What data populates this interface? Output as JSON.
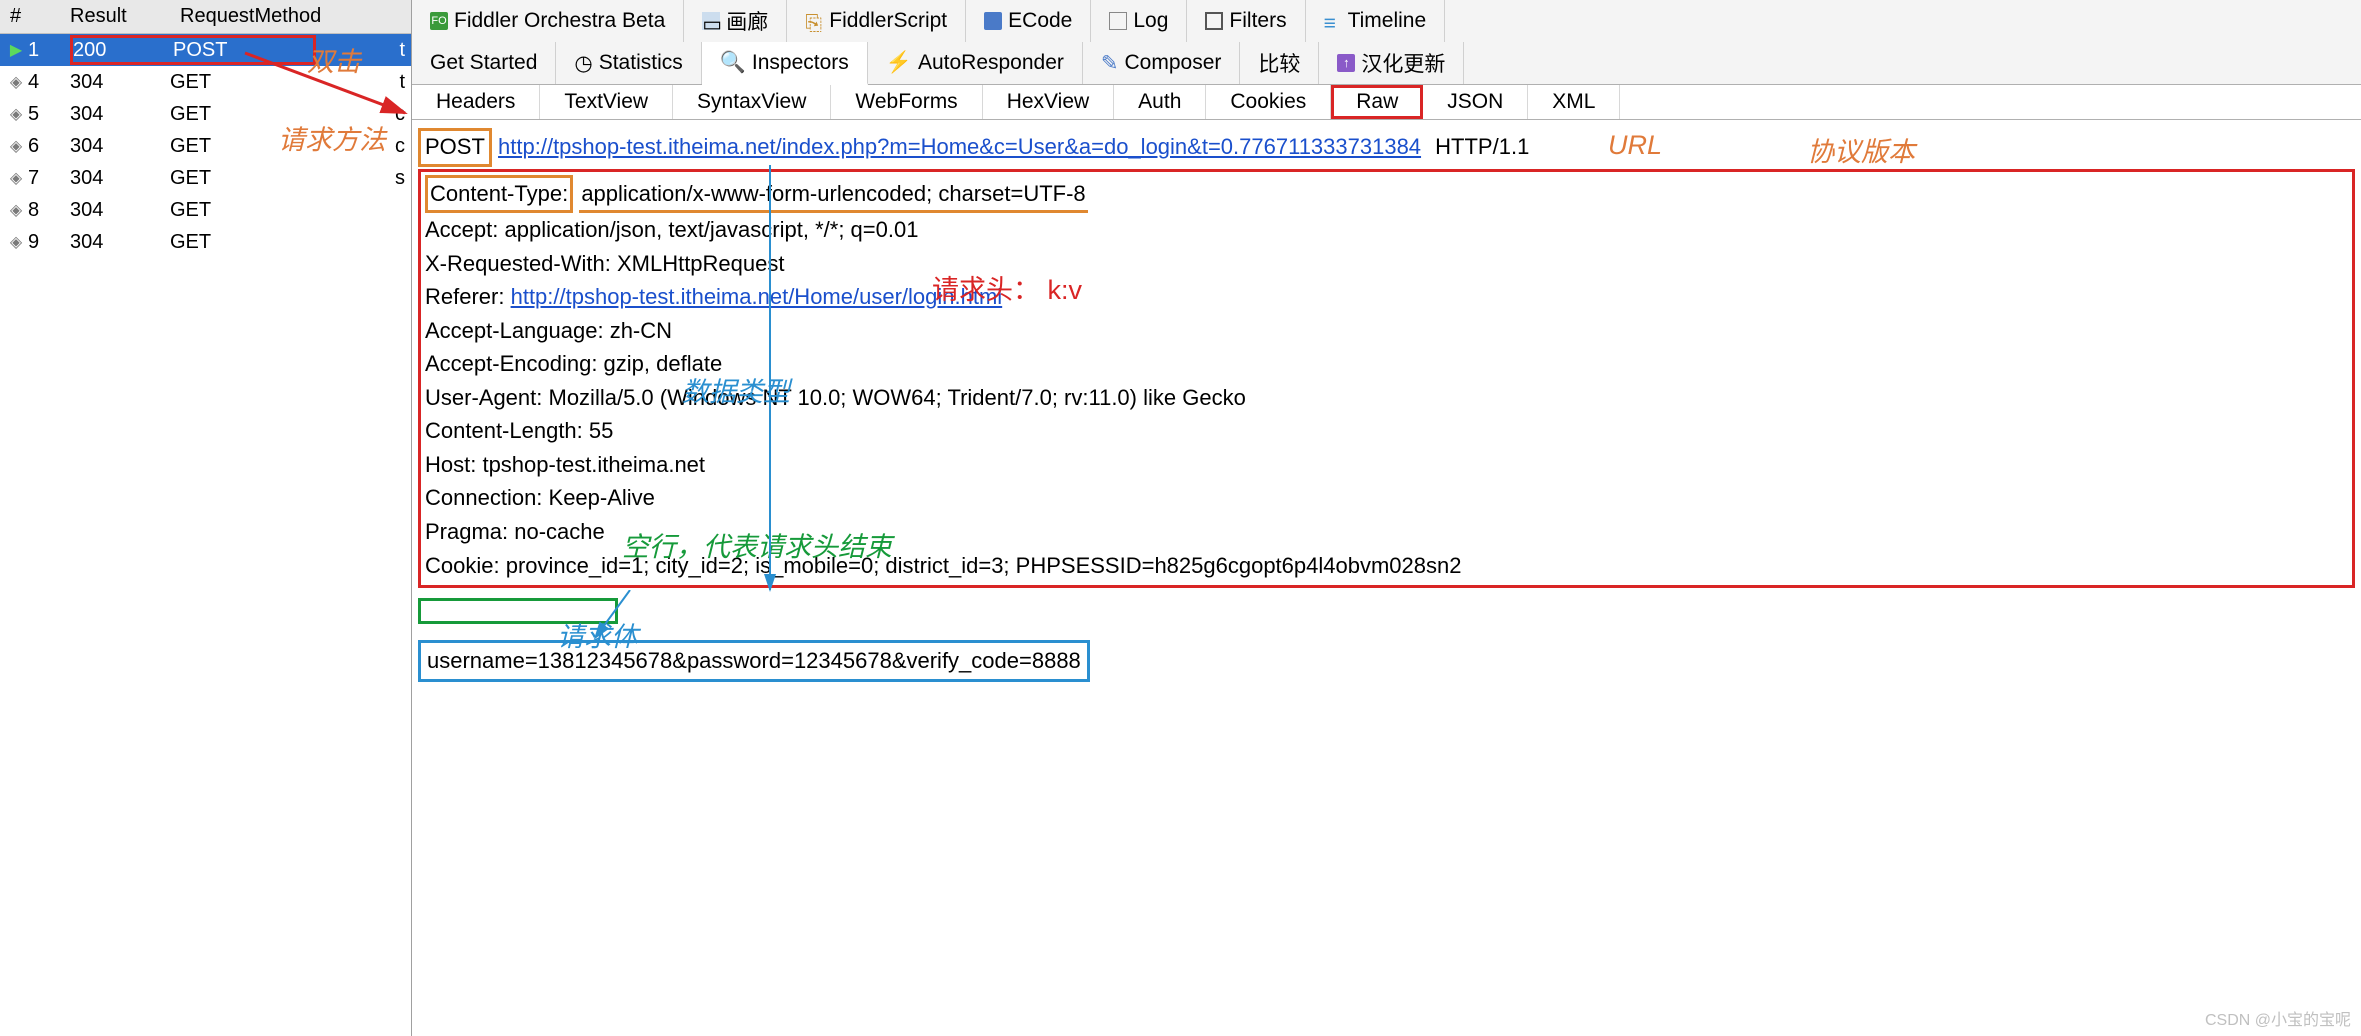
{
  "left": {
    "headers": {
      "num": "#",
      "result": "Result",
      "method": "RequestMethod"
    },
    "rows": [
      {
        "icon": "▶",
        "num": "1",
        "result": "200",
        "method": "POST",
        "extra": "t",
        "selected": true
      },
      {
        "icon": "◈",
        "num": "4",
        "result": "304",
        "method": "GET",
        "extra": "t"
      },
      {
        "icon": "◈",
        "num": "5",
        "result": "304",
        "method": "GET",
        "extra": "c"
      },
      {
        "icon": "◈",
        "num": "6",
        "result": "304",
        "method": "GET",
        "extra": "c"
      },
      {
        "icon": "◈",
        "num": "7",
        "result": "304",
        "method": "GET",
        "extra": "s"
      },
      {
        "icon": "◈",
        "num": "8",
        "result": "304",
        "method": "GET",
        "extra": ""
      },
      {
        "icon": "◈",
        "num": "9",
        "result": "304",
        "method": "GET",
        "extra": ""
      }
    ]
  },
  "tabs_row1": [
    {
      "label": "Fiddler Orchestra Beta",
      "icon": "FO"
    },
    {
      "label": "画廊",
      "icon": "img"
    },
    {
      "label": "FiddlerScript",
      "icon": "js"
    },
    {
      "label": "ECode",
      "icon": "e"
    },
    {
      "label": "Log",
      "icon": "log"
    },
    {
      "label": "Filters",
      "icon": "sq"
    },
    {
      "label": "Timeline",
      "icon": "tl"
    }
  ],
  "tabs_row2": [
    {
      "label": "Get Started",
      "icon": ""
    },
    {
      "label": "Statistics",
      "icon": "clock"
    },
    {
      "label": "Inspectors",
      "icon": "insp",
      "active": true
    },
    {
      "label": "AutoResponder",
      "icon": "bolt"
    },
    {
      "label": "Composer",
      "icon": "edit"
    },
    {
      "label": "比较",
      "icon": ""
    },
    {
      "label": "汉化更新",
      "icon": "up"
    }
  ],
  "sub_tabs": [
    "Headers",
    "TextView",
    "SyntaxView",
    "WebForms",
    "HexView",
    "Auth",
    "Cookies",
    "Raw",
    "JSON",
    "XML"
  ],
  "raw": {
    "method": "POST",
    "url": "http://tpshop-test.itheima.net/index.php?m=Home&c=User&a=do_login&t=0.776711333731384",
    "http_version": "HTTP/1.1",
    "content_type_key": "Content-Type:",
    "content_type_val": "application/x-www-form-urlencoded; charset=UTF-8",
    "headers": [
      "Accept: application/json, text/javascript, */*; q=0.01",
      "X-Requested-With: XMLHttpRequest"
    ],
    "referer_key": "Referer: ",
    "referer_url": "http://tpshop-test.itheima.net/Home/user/login.html",
    "headers2": [
      "Accept-Language: zh-CN",
      "Accept-Encoding: gzip, deflate",
      "User-Agent: Mozilla/5.0 (Windows NT 10.0; WOW64; Trident/7.0; rv:11.0) like Gecko",
      "Content-Length: 55",
      "Host: tpshop-test.itheima.net",
      "Connection: Keep-Alive",
      "Pragma: no-cache",
      "Cookie: province_id=1; city_id=2; is_mobile=0; district_id=3; PHPSESSID=h825g6cgopt6p4l4obvm028sn2"
    ],
    "body": "username=13812345678&password=12345678&verify_code=8888"
  },
  "annotations": {
    "dblclick": "双击",
    "req_method": "请求方法",
    "url_label": "URL",
    "proto_ver": "协议版本",
    "data_type": "数据类型",
    "req_headers": "请求头： k:v",
    "blank_line": "空行，代表请求头结束",
    "req_body": "请求体"
  },
  "watermark": "CSDN @小宝的宝呢"
}
